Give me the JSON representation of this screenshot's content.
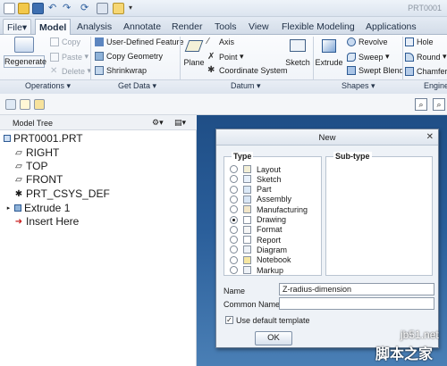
{
  "window": {
    "title": "PRT0001"
  },
  "quick_access": [
    "new-icon",
    "open-icon",
    "save-icon",
    "undo-icon",
    "redo-icon",
    "regenerate-icon",
    "windows-icon",
    "close-icon",
    "customize-icon"
  ],
  "tabs": [
    "File",
    "Model",
    "Analysis",
    "Annotate",
    "Render",
    "Tools",
    "View",
    "Flexible Modeling",
    "Applications"
  ],
  "active_tab": "Model",
  "ribbon": {
    "operations": {
      "regenerate": "Regenerate",
      "copy": "Copy",
      "paste": "Paste",
      "delete": "Delete",
      "label": "Operations"
    },
    "get_data": {
      "udf": "User-Defined Feature",
      "copy_geometry": "Copy Geometry",
      "shrinkwrap": "Shrinkwrap",
      "label": "Get Data"
    },
    "datum": {
      "plane": "Plane",
      "axis": "Axis",
      "point": "Point",
      "csys": "Coordinate System",
      "sketch": "Sketch",
      "label": "Datum"
    },
    "shapes": {
      "extrude": "Extrude",
      "revolve": "Revolve",
      "sweep": "Sweep",
      "swept_blend": "Swept Blend",
      "label": "Shapes"
    },
    "engineering": {
      "hole": "Hole",
      "round": "Round",
      "chamfer": "Chamfer",
      "label": "Engine"
    }
  },
  "tree": {
    "header": "Model Tree",
    "items": [
      "PRT0001.PRT",
      "RIGHT",
      "TOP",
      "FRONT",
      "PRT_CSYS_DEF",
      "Extrude 1",
      "Insert Here"
    ]
  },
  "dialog": {
    "title": "New",
    "type_label": "Type",
    "subtype_label": "Sub-type",
    "types": [
      "Layout",
      "Sketch",
      "Part",
      "Assembly",
      "Manufacturing",
      "Drawing",
      "Format",
      "Report",
      "Diagram",
      "Notebook",
      "Markup"
    ],
    "selected_type": "Drawing",
    "name_label": "Name",
    "name_value": "Z-radius-dimension",
    "common_name_label": "Common Name",
    "common_name_value": "",
    "use_default_template": "Use default template",
    "use_default_checked": true,
    "ok": "OK"
  },
  "watermark": {
    "line1": "jb51.net",
    "line2": "脚本之家"
  }
}
